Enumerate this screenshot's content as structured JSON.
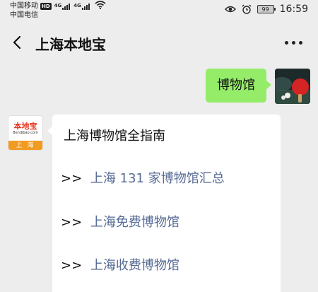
{
  "status_bar": {
    "carrier_1": "中国移动",
    "carrier_1_badge": "HD",
    "carrier_1_net": "4G",
    "carrier_2": "中国电信",
    "carrier_2_net": "4G",
    "battery": "99",
    "time": "16:59"
  },
  "header": {
    "title": "上海本地宝",
    "back_icon": "chevron-left-icon",
    "more_icon": "more-dots-icon"
  },
  "messages": {
    "outgoing": {
      "text": "博物馆"
    },
    "incoming": {
      "avatar_logo": "本地宝",
      "avatar_domain": "Bendibao.com",
      "avatar_city": "上 海",
      "heading": "上海博物馆全指南",
      "links": [
        {
          "prefix": ">>",
          "text": "上海 131 家博物馆汇总"
        },
        {
          "prefix": ">>",
          "text": "上海免费博物馆"
        },
        {
          "prefix": ">>",
          "text": "上海收费博物馆"
        }
      ]
    }
  },
  "colors": {
    "background": "#ededed",
    "outgoing_bubble": "#95ec69",
    "link": "#576b95",
    "brand_red": "#e8321e",
    "brand_orange": "#f29b21"
  }
}
